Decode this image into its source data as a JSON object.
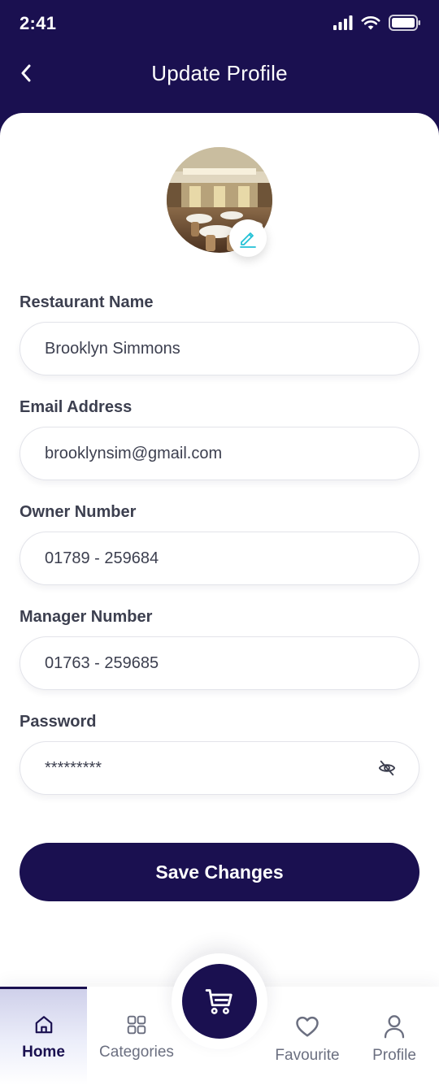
{
  "status_bar": {
    "time": "2:41"
  },
  "header": {
    "title": "Update Profile"
  },
  "form": {
    "restaurant_name": {
      "label": "Restaurant Name",
      "value": "Brooklyn Simmons"
    },
    "email": {
      "label": "Email Address",
      "value": "brooklynsim@gmail.com"
    },
    "owner_number": {
      "label": "Owner Number",
      "value": "01789 - 259684"
    },
    "manager_number": {
      "label": "Manager Number",
      "value": "01763 - 259685"
    },
    "password": {
      "label": "Password",
      "value": "*********"
    }
  },
  "actions": {
    "save_label": "Save Changes"
  },
  "bottom_nav": {
    "items": [
      {
        "label": "Home",
        "icon": "home-icon",
        "active": true
      },
      {
        "label": "Categories",
        "icon": "grid-icon"
      },
      {
        "label": "Favourite",
        "icon": "heart-icon"
      },
      {
        "label": "Profile",
        "icon": "user-icon"
      }
    ],
    "center_icon": "cart-icon"
  },
  "colors": {
    "primary": "#1a1050",
    "accent": "#22c1d6",
    "text": "#3c3f4f",
    "muted": "#6b6f80",
    "border": "#e3e4ea"
  }
}
